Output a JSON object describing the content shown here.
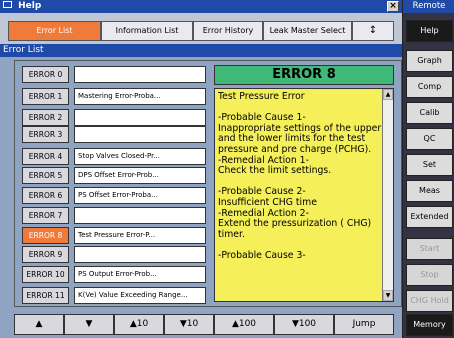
{
  "window": {
    "title": "Help"
  },
  "tabs": [
    "Error List",
    "Information List",
    "Error History",
    "Leak Master Select",
    "↕"
  ],
  "list_title": "Error List",
  "errors": [
    {
      "id": "ERROR 0",
      "text": ""
    },
    {
      "id": "ERROR 1",
      "text": "Mastering Error-Proba..."
    },
    {
      "id": "ERROR 2",
      "text": ""
    },
    {
      "id": "ERROR 3",
      "text": ""
    },
    {
      "id": "ERROR 4",
      "text": "Stop Valves Closed-Pr..."
    },
    {
      "id": "ERROR 5",
      "text": "DPS Offset Error-Prob..."
    },
    {
      "id": "ERROR 6",
      "text": "PS Offset Error-Proba..."
    },
    {
      "id": "ERROR 7",
      "text": ""
    },
    {
      "id": "ERROR 8",
      "text": "Test Pressure Error-P..."
    },
    {
      "id": "ERROR 9",
      "text": ""
    },
    {
      "id": "ERROR 10",
      "text": "PS Output Error-Prob..."
    },
    {
      "id": "ERROR 11",
      "text": "K(Ve) Value Exceeding Range..."
    }
  ],
  "selected_error": "ERROR 8",
  "detail": {
    "title": "ERROR 8",
    "text": "Test Pressure Error\n\n-Probable Cause 1-\nInappropriate settings of the upper and the lower limits for the test pressure and pre charge (PCHG).\n-Remedial Action 1-\nCheck the limit settings.\n\n-Probable Cause 2-\nInsufficient CHG time\n-Remedial Action 2-\nExtend the pressurization ( CHG) timer.\n\n-Probable Cause 3-"
  },
  "nav": [
    "▲",
    "▼",
    "▲10",
    "▼10",
    "▲100",
    "▼100",
    "Jump"
  ],
  "right_panel": {
    "title": "Remote",
    "buttons": [
      "Help",
      "Graph",
      "Comp",
      "Calib",
      "QC",
      "Set",
      "Meas",
      "Extended",
      "Start",
      "Stop",
      "CHG Hold",
      "Memory"
    ]
  },
  "colors": {
    "accent": "#f07a3a",
    "header": "#1f4aa8",
    "detail_head": "#3fb878",
    "detail_bg": "#f5ef5a"
  }
}
